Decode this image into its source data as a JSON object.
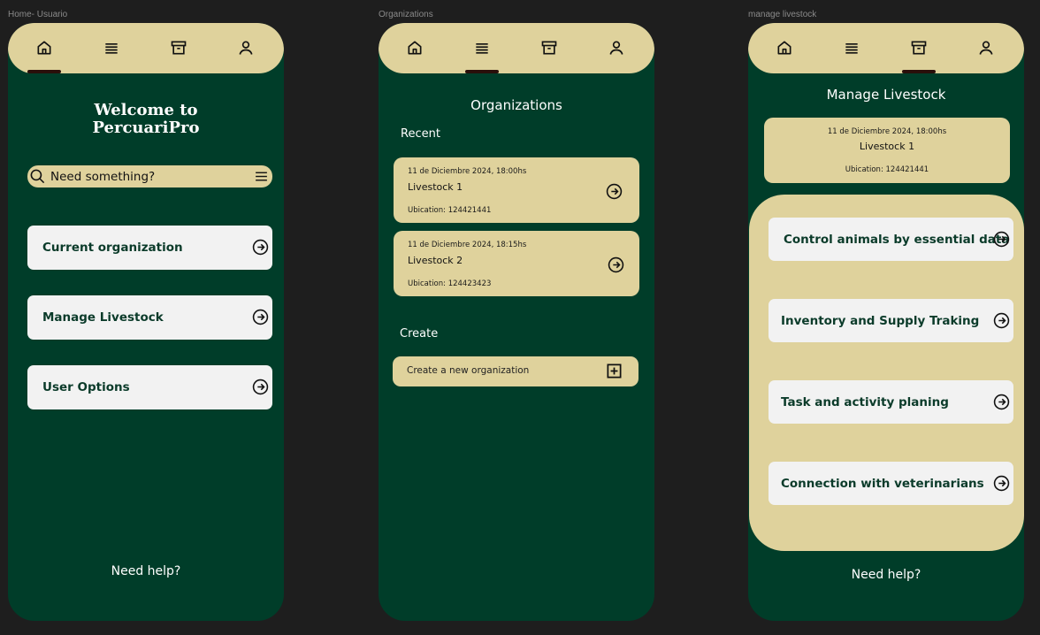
{
  "frames": {
    "home": {
      "label": "Home- Usuario"
    },
    "organizations": {
      "label": "Organizations"
    },
    "manage": {
      "label": "manage livestock"
    }
  },
  "nav": {
    "icons": [
      "home-icon",
      "menu-icon",
      "archive-icon",
      "user-icon"
    ]
  },
  "home": {
    "welcome_line1": "Welcome to",
    "welcome_line2": "PercuariPro",
    "search_placeholder": "Need something?",
    "items": [
      {
        "label": "Current organization"
      },
      {
        "label": "Manage Livestock"
      },
      {
        "label": "User Options"
      }
    ],
    "help": "Need help?"
  },
  "organizations": {
    "title": "Organizations",
    "recent_label": "Recent",
    "recent": [
      {
        "date": "11 de Diciembre 2024, 18:00hs",
        "name": "Livestock 1",
        "ubication": "Ubication: 124421441"
      },
      {
        "date": "11 de Diciembre 2024, 18:15hs",
        "name": "Livestock 2",
        "ubication": "Ubication: 124423423"
      }
    ],
    "create_label": "Create",
    "create_button": "Create a new organization"
  },
  "manage": {
    "title": "Manage Livestock",
    "current": {
      "date": "11 de Diciembre 2024, 18:00hs",
      "name": "Livestock 1",
      "ubication": "Ubication: 124421441"
    },
    "items": [
      {
        "label": "Control animals by essential data"
      },
      {
        "label": "Inventory and Supply Traking"
      },
      {
        "label": "Task and activity planing"
      },
      {
        "label": "Connection with veterinarians"
      }
    ],
    "help": "Need help?"
  },
  "colors": {
    "background": "#1e1e1e",
    "phone": "#003d29",
    "beige": "#dfd29c",
    "card": "#f2f2f2",
    "indicator": "#2a0f0a",
    "text_dark": "#0b3b2a"
  }
}
